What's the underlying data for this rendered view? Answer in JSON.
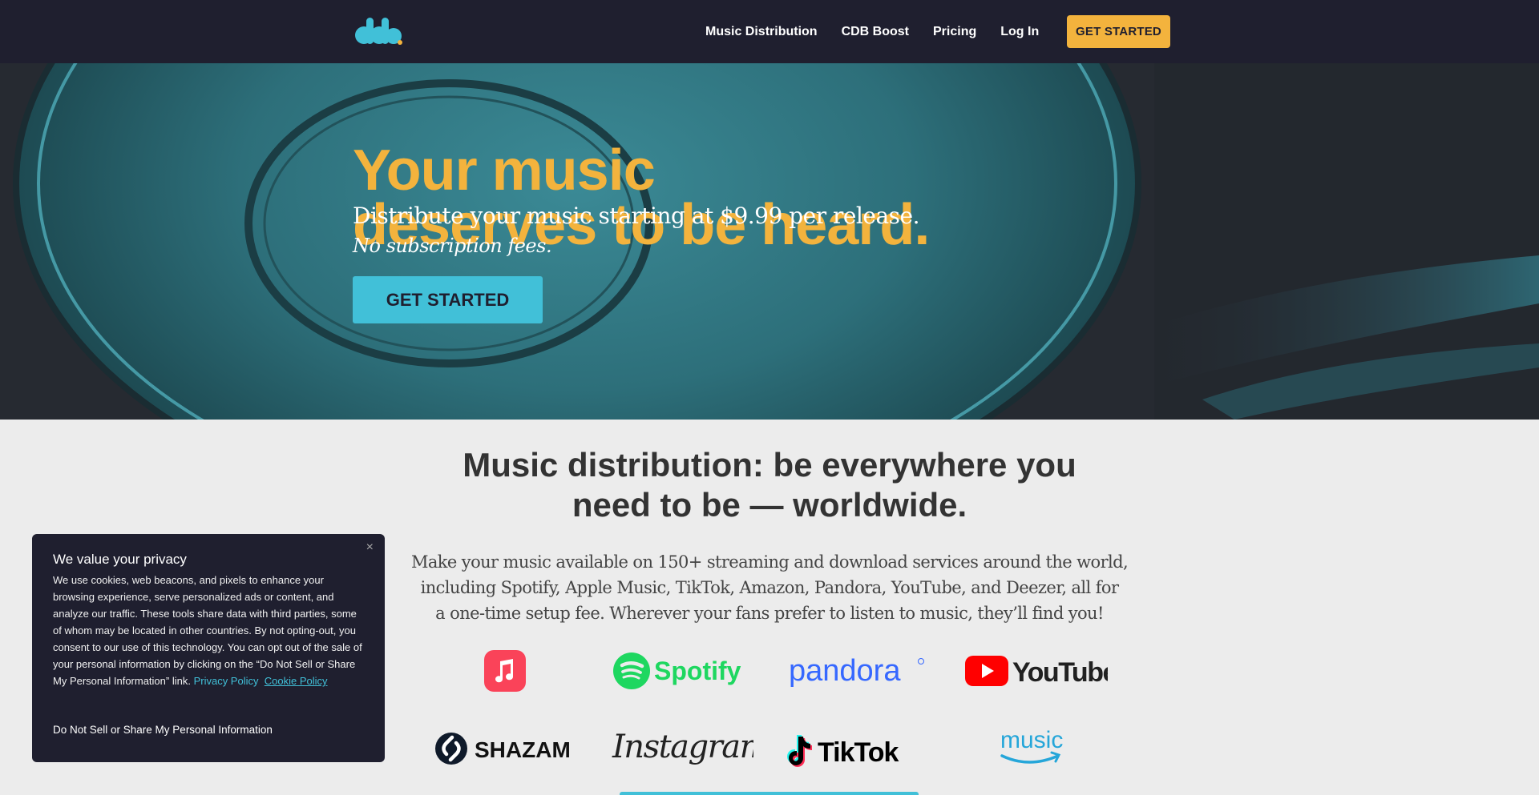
{
  "nav": {
    "links": [
      "Music Distribution",
      "CDB Boost",
      "Pricing",
      "Log In"
    ],
    "cta": "GET STARTED"
  },
  "hero": {
    "title_line1": "Your music",
    "title_line2": "deserves to be heard.",
    "subtitle": "Distribute your music starting at $9.99 per release.",
    "subtitle2": "No subscription fees.",
    "cta": "GET STARTED"
  },
  "distribution": {
    "title_line1": "Music distribution: be everywhere you",
    "title_line2": "need to be — worldwide.",
    "text_line1": "Make your music available on 150+ streaming and download services around the world,",
    "text_line2": "including Spotify, Apple Music, TikTok, Amazon, Pandora, YouTube, and Deezer, all for",
    "text_line3": "a one-time setup fee. Wherever your fans prefer to listen to music, they’ll find you!",
    "logos": {
      "spotify": "Spotify",
      "pandora": "pandora",
      "youtube": "YouTube",
      "shazam": "SHAZAM",
      "instagram": "Instagram",
      "tiktok": "TikTok",
      "amazon_music": "music"
    }
  },
  "cookie": {
    "close": "×",
    "title": "We value your privacy",
    "body": "We use cookies, web beacons, and pixels to enhance your browsing experience, serve personalized ads or content, and analyze our traffic. These tools share data with third parties, some of whom may be located in other countries. By not opting-out, you consent to our use of this technology. You can opt out of the sale of your personal information by clicking on the “Do Not Sell or Share My Personal Information” link.",
    "privacy_link": "Privacy Policy",
    "cookie_link": "Cookie Policy",
    "do_not_sell": "Do Not Sell or Share My Personal Information"
  },
  "colors": {
    "nav_bg": "#1f1f2f",
    "accent_yellow": "#f3b33d",
    "accent_teal": "#41c0d8",
    "page_bg": "#ececec"
  }
}
